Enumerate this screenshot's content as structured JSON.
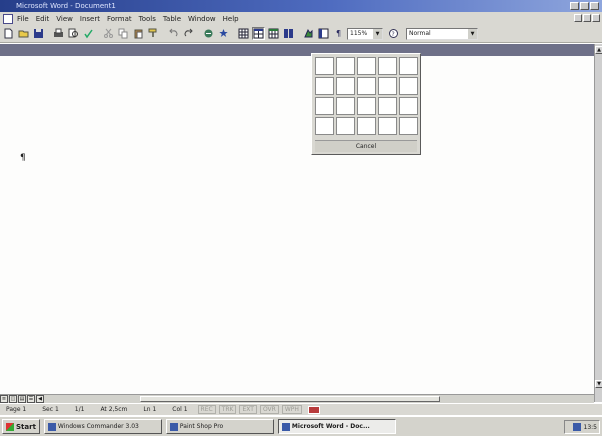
{
  "window": {
    "title": "Microsoft Word - Document1"
  },
  "menu": {
    "items": [
      "File",
      "Edit",
      "View",
      "Insert",
      "Format",
      "Tools",
      "Table",
      "Window",
      "Help"
    ]
  },
  "toolbar": {
    "buttons": [
      "new-document",
      "open",
      "save",
      "print",
      "print-preview",
      "spelling",
      "cut",
      "copy",
      "paste",
      "format-painter",
      "undo",
      "redo",
      "insert-hyperlink",
      "web-toolbar",
      "tables-and-borders",
      "insert-table",
      "insert-excel-worksheet",
      "columns",
      "drawing",
      "document-map",
      "show-hide"
    ],
    "zoom": "115%",
    "style": "Normal"
  },
  "table_grid": {
    "rows": 4,
    "cols": 5,
    "cancel_label": "Cancel"
  },
  "document": {
    "paragraph_mark": "¶"
  },
  "status": {
    "page": "Page 1",
    "section": "Sec 1",
    "pages": "1/1",
    "at": "At 2,5cm",
    "line": "Ln 1",
    "col": "Col 1",
    "modes": [
      "REC",
      "TRK",
      "EXT",
      "OVR",
      "WPH"
    ]
  },
  "taskbar": {
    "start_label": "Start",
    "tasks": [
      "Windows Commander 3.03",
      "Paint Shop Pro",
      "Microsoft Word - Doc..."
    ],
    "tray_time": "13:5"
  },
  "colors": {
    "titlebar_start": "#263e8a",
    "chrome": "#d9d8d2",
    "ruler": "#6e7088",
    "page": "#fdfdfc"
  }
}
